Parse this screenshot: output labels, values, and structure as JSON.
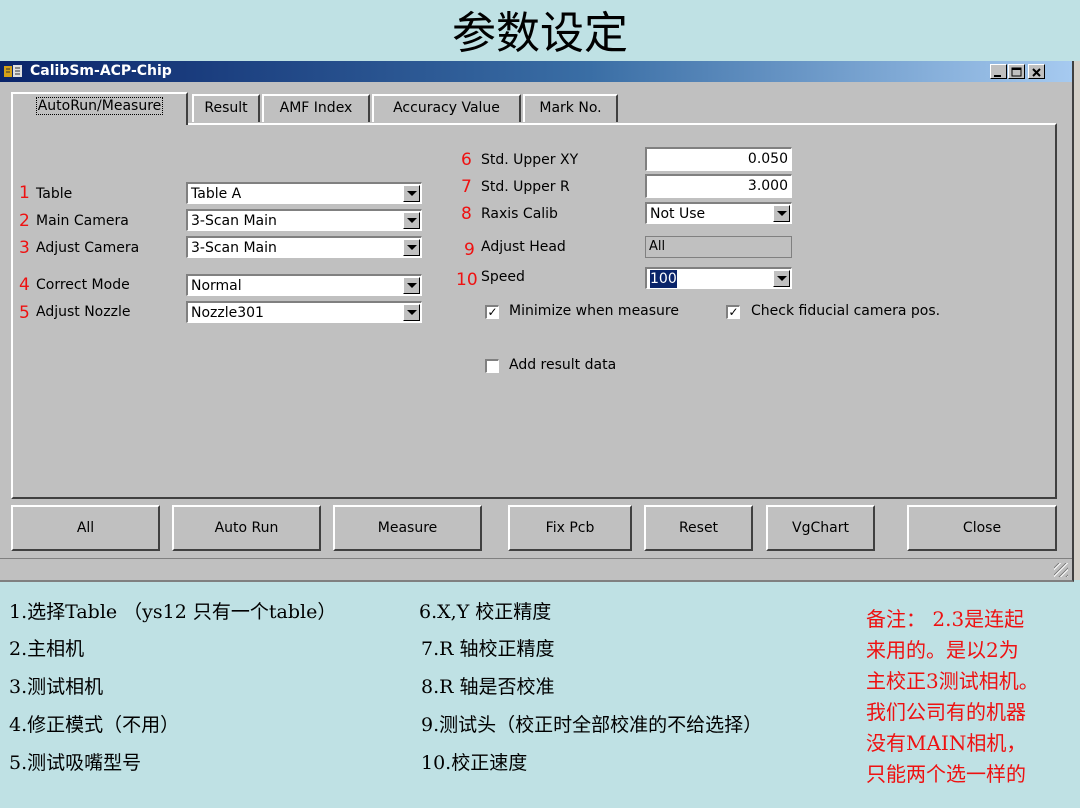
{
  "slide_title": "参数设定",
  "window": {
    "title": "CalibSm-ACP-Chip",
    "controls": {
      "minimize": "_",
      "maximize": "□",
      "close": "×"
    }
  },
  "tabs": [
    {
      "label": "AutoRun/Measure",
      "active": true
    },
    {
      "label": "Result"
    },
    {
      "label": "AMF Index"
    },
    {
      "label": "Accuracy Value"
    },
    {
      "label": "Mark No."
    }
  ],
  "left_fields": [
    {
      "num": "1",
      "label": "Table",
      "value": "Table A"
    },
    {
      "num": "2",
      "label": "Main Camera",
      "value": "3-Scan Main"
    },
    {
      "num": "3",
      "label": "Adjust Camera",
      "value": "3-Scan Main"
    },
    {
      "num": "4",
      "label": "Correct Mode",
      "value": "Normal"
    },
    {
      "num": "5",
      "label": "Adjust Nozzle",
      "value": "Nozzle301"
    }
  ],
  "right_fields": [
    {
      "num": "6",
      "label": "Std. Upper XY",
      "value": "0.050"
    },
    {
      "num": "7",
      "label": "Std. Upper R",
      "value": "3.000"
    },
    {
      "num": "8",
      "label": "Raxis Calib",
      "value": "Not Use"
    },
    {
      "num": "9",
      "label": "Adjust Head",
      "value": "All"
    },
    {
      "num": "10",
      "label": "Speed",
      "value": "100"
    }
  ],
  "checkboxes": [
    {
      "label": "Minimize when measure",
      "checked": true
    },
    {
      "label": "Check fiducial camera pos.",
      "checked": true
    },
    {
      "label": "Add result data",
      "checked": false
    }
  ],
  "buttons": [
    "All",
    "Auto Run",
    "Measure",
    "Fix Pcb",
    "Reset",
    "VgChart",
    "Close"
  ],
  "notes_left": [
    "1.选择Table （ys12 只有一个table）",
    "2.主相机",
    "3.测试相机",
    "4.修正模式（不用）",
    "5.测试吸嘴型号"
  ],
  "notes_mid": [
    "6.X,Y 校正精度",
    "7.R 轴校正精度",
    "8.R 轴是否校准",
    "9.测试头（校正时全部校准的不给选择）",
    "10.校正速度"
  ],
  "remark_lines": [
    "备注： 2.3是连起",
    "来用的。是以2为",
    "主校正3测试相机。",
    "我们公司有的机器",
    "没有MAIN相机，",
    "只能两个选一样的"
  ],
  "colors": {
    "background": "#bfe1e4",
    "window": "#c0c0c0",
    "accent_red": "#ee1111",
    "titlebar": "#0a246a"
  }
}
